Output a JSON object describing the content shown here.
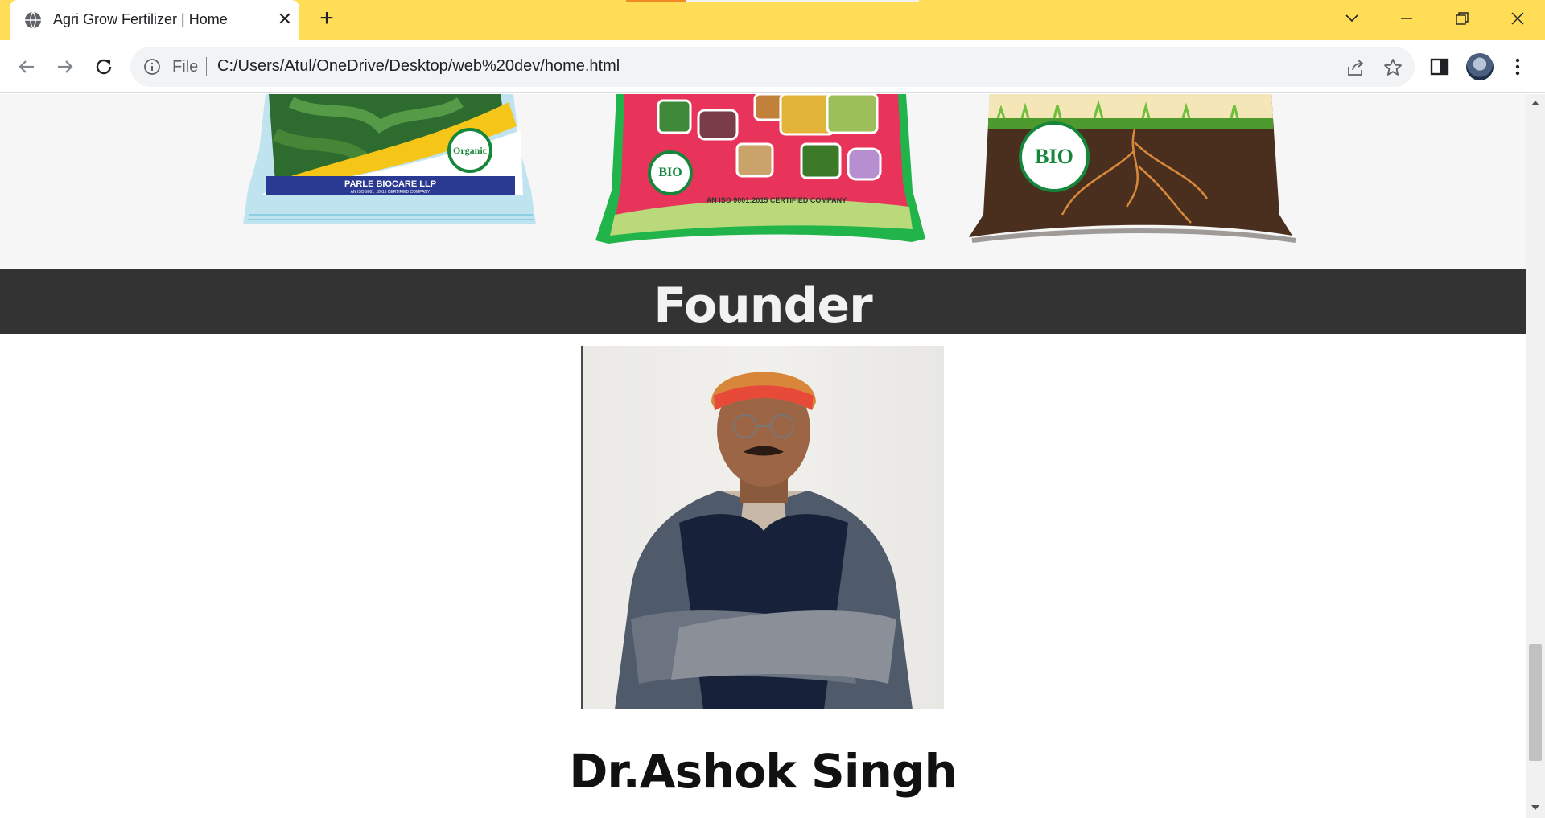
{
  "browser": {
    "tab_title": "Agri Grow Fertilizer | Home",
    "tab_close": "✕",
    "new_tab": "+",
    "scheme": "File",
    "url": "C:/Users/Atul/OneDrive/Desktop/web%20dev/home.html",
    "theme_color": "#ffdd57"
  },
  "products": [
    {
      "name": "organic-fertilizer-pack",
      "company": "PARLE BIOCARE LLP",
      "certification": "AN ISO 9001 : 2015 CERTIFIED COMPANY",
      "badge": "Organic"
    },
    {
      "name": "bio-fertilizer-green-pack",
      "certification": "AN ISO 9001:2015 CERTIFIED COMPANY",
      "badge": "BIO"
    },
    {
      "name": "bio-fertilizer-soil-pack",
      "badge": "BIO"
    }
  ],
  "founder": {
    "heading": "Founder",
    "name": "Dr.Ashok Singh"
  },
  "icons": [
    "globe-icon",
    "close-icon",
    "plus-icon",
    "chevron-down-icon",
    "minimize-icon",
    "restore-icon",
    "window-close-icon",
    "back-icon",
    "forward-icon",
    "reload-icon",
    "info-icon",
    "share-icon",
    "star-icon",
    "side-panel-icon",
    "menu-icon",
    "scroll-up-icon",
    "scroll-down-icon"
  ]
}
